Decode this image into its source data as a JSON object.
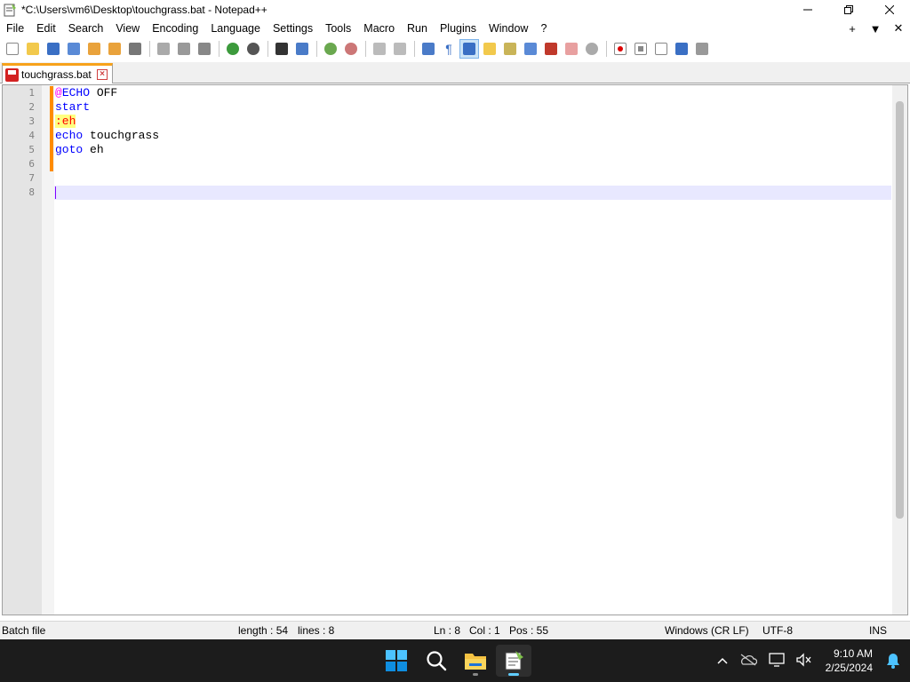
{
  "window": {
    "title": "*C:\\Users\\vm6\\Desktop\\touchgrass.bat - Notepad++"
  },
  "menu": {
    "items": [
      "File",
      "Edit",
      "Search",
      "View",
      "Encoding",
      "Language",
      "Settings",
      "Tools",
      "Macro",
      "Run",
      "Plugins",
      "Window",
      "?"
    ],
    "right": [
      "+",
      "▼",
      "✕"
    ]
  },
  "toolbar": {
    "buttons": [
      "new-file",
      "open-file",
      "save",
      "save-all",
      "close",
      "close-all",
      "print",
      "cut",
      "copy",
      "paste",
      "undo",
      "redo",
      "find",
      "replace",
      "zoom-in",
      "zoom-out",
      "sync-vertical",
      "sync-horizontal",
      "word-wrap",
      "show-all-chars",
      "indent-guide",
      "udl",
      "doc-map",
      "doc-list",
      "function-list",
      "folder-as-workspace",
      "monitoring",
      "record-macro",
      "stop-recording",
      "playback-macro",
      "run-macro-multiple",
      "save-macro"
    ]
  },
  "tabs": [
    {
      "label": "touchgrass.bat",
      "active": true
    }
  ],
  "editor": {
    "line_numbers": [
      "1",
      "2",
      "3",
      "4",
      "5",
      "6",
      "7",
      "8"
    ],
    "lines": [
      {
        "tokens": [
          {
            "t": "@",
            "c": "at"
          },
          {
            "t": "ECHO",
            "c": "kw"
          },
          {
            "t": " OFF",
            "c": ""
          }
        ]
      },
      {
        "tokens": [
          {
            "t": "start",
            "c": "kw"
          }
        ]
      },
      {
        "tokens": [
          {
            "t": ":eh",
            "c": "lbl"
          }
        ]
      },
      {
        "tokens": [
          {
            "t": "echo",
            "c": "kw"
          },
          {
            "t": " touchgrass",
            "c": ""
          }
        ]
      },
      {
        "tokens": [
          {
            "t": "goto",
            "c": "kw"
          },
          {
            "t": " eh",
            "c": ""
          }
        ]
      },
      {
        "tokens": []
      },
      {
        "tokens": []
      },
      {
        "tokens": [],
        "current": true
      }
    ]
  },
  "status": {
    "file_type": "Batch file",
    "length": "length : 54",
    "lines": "lines : 8",
    "ln": "Ln : 8",
    "col": "Col : 1",
    "pos": "Pos : 55",
    "eol": "Windows (CR LF)",
    "encoding": "UTF-8",
    "mode": "INS"
  },
  "taskbar": {
    "apps": [
      "start-button",
      "search",
      "file-explorer",
      "notepad-plus-plus"
    ],
    "clock_time": "9:10 AM",
    "clock_date": "2/25/2024"
  },
  "colors": {
    "tab_accent": "#f7a21b",
    "keyword": "#0000ff",
    "label_bg": "#ffff80",
    "change_bar": "#ff8c00",
    "current_line": "#e8e8ff",
    "taskbar_bg": "#1c1c1c",
    "accent_blue": "#60cdff"
  }
}
